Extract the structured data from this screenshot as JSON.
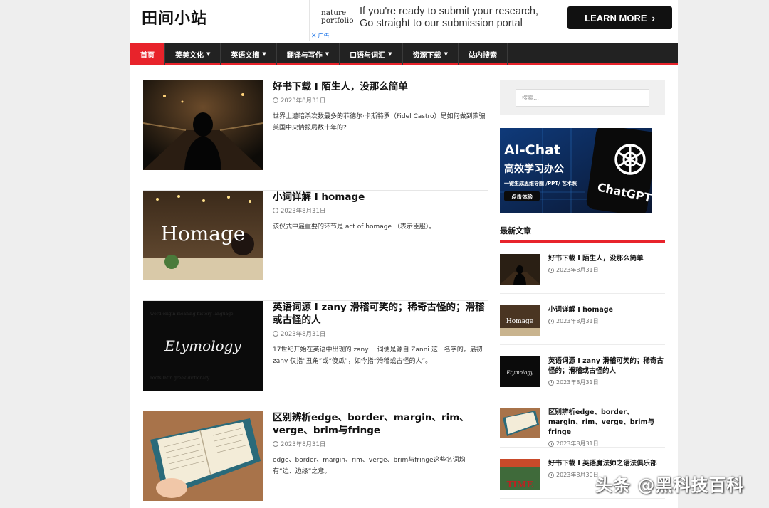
{
  "site": {
    "title": "田间小站"
  },
  "ad": {
    "logo_line1": "nature",
    "logo_line2": "portfolio",
    "line1": "If you're ready to submit your research,",
    "line2": "Go straight to our submission portal",
    "button_label": "LEARN MORE",
    "label": "广告"
  },
  "nav": {
    "items": [
      {
        "label": "首页",
        "active": true
      },
      {
        "label": "英美文化",
        "dropdown": true
      },
      {
        "label": "英语文摘",
        "dropdown": true
      },
      {
        "label": "翻译与写作",
        "dropdown": true
      },
      {
        "label": "口语与词汇",
        "dropdown": true
      },
      {
        "label": "资源下载",
        "dropdown": true
      },
      {
        "label": "站内搜索"
      }
    ]
  },
  "posts": [
    {
      "title": "好书下载 I 陌生人，没那么简单",
      "date": "2023年8月31日",
      "excerpt": "世界上遭暗杀次数最多的菲德尔·卡斯特罗（Fidel Castro）是如何做到欺骗美国中央情报局数十年的?",
      "thumb_icon": "person-on-bridge-photo"
    },
    {
      "title": "小词详解 I homage",
      "date": "2023年8月31日",
      "excerpt": "该仪式中最重要的环节是 act of homage （表示臣服）。",
      "thumb_text": "Homage",
      "thumb_icon": "banquet-photo"
    },
    {
      "title": "英语词源 I zany 滑稽可笑的；稀奇古怪的；滑稽或古怪的人",
      "date": "2023年8月31日",
      "excerpt": "17世纪开始在英语中出现的 zany 一词便是源自 Zanni 这一名字的。最初 zany 仅指“丑角”或“傻瓜”，如今指“滑稽或古怪的人”。",
      "thumb_text": "Etymology",
      "thumb_icon": "etymology-photo"
    },
    {
      "title": "区别辨析edge、border、margin、rim、verge、brim与fringe",
      "date": "2023年8月31日",
      "excerpt": "edge、border、margin、rim、verge、brim与fringe这些名词均有“边、边缘”之意。",
      "thumb_icon": "open-book-photo"
    }
  ],
  "sidebar": {
    "search_placeholder": "搜索…",
    "banner": {
      "title": "AI-Chat",
      "subtitle": "高效学习办公",
      "tagline": "一键生成思维导图 /PPT/ 艺术照",
      "button": "点击体验",
      "brand": "ChatGPT"
    },
    "recent_title": "最新文章",
    "recent": [
      {
        "title": "好书下载 I 陌生人，没那么简单",
        "date": "2023年8月31日"
      },
      {
        "title": "小词详解 I homage",
        "date": "2023年8月31日",
        "thumb_text": "Homage"
      },
      {
        "title": "英语词源 I zany 滑稽可笑的；稀奇古怪的；滑稽或古怪的人",
        "date": "2023年8月31日",
        "thumb_text": "Etymology"
      },
      {
        "title": "区别辨析edge、border、margin、rim、verge、brim与fringe",
        "date": "2023年8月31日"
      },
      {
        "title": "好书下载 I 英语魔法师之语法俱乐部",
        "date": "2023年8月30日",
        "thumb_text": "TIME"
      }
    ]
  },
  "watermark": "头条 @黑科技百科",
  "colors": {
    "accent": "#e8232b",
    "nav_bg": "#222222"
  }
}
